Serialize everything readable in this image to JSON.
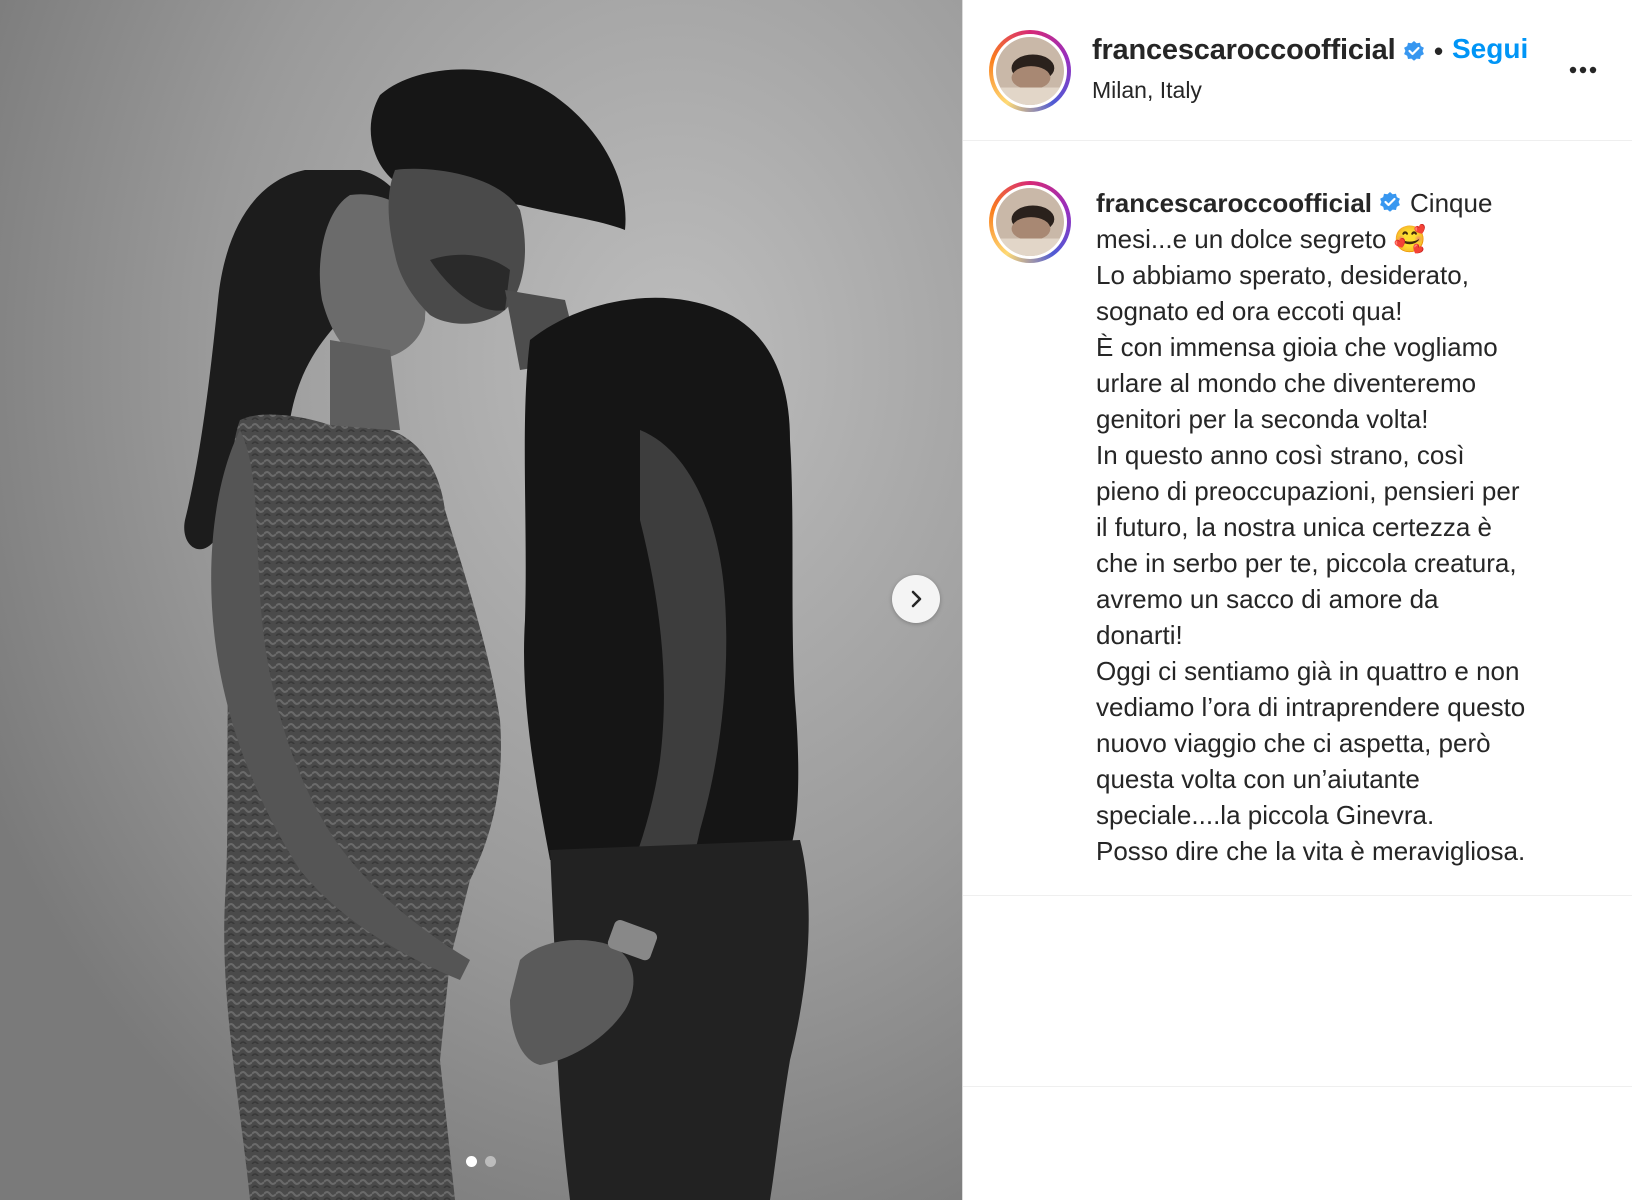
{
  "post": {
    "username": "francescaroccoofficial",
    "follow_label": "Segui",
    "separator": "•",
    "location": "Milan, Italy",
    "verified": true
  },
  "caption": {
    "username": "francescaroccoofficial",
    "first_line_text": "Cinque",
    "lines": [
      "mesi...e un dolce segreto 🥰",
      "Lo abbiamo sperato, desiderato,",
      "sognato ed ora eccoti qua!",
      "È con immensa gioia che vogliamo",
      "urlare al mondo che diventeremo",
      "genitori per la seconda volta!",
      "In questo anno così strano, così",
      "pieno di preoccupazioni, pensieri per",
      "il futuro, la nostra unica certezza è",
      "che in serbo per te, piccola creatura,",
      "avremo un sacco di amore da",
      "donarti!",
      "Oggi ci sentiamo già in quattro e non",
      "vediamo l’ora di intraprendere questo",
      "nuovo viaggio che ci aspetta, però",
      "questa volta con un’aiutante",
      "speciale....la piccola Ginevra.",
      "Posso dire che la vita è meravigliosa."
    ]
  },
  "carousel": {
    "total_slides": 2,
    "active_slide": 1
  },
  "colors": {
    "accent": "#0095f6",
    "verified": "#3897f0",
    "text": "#262626",
    "border": "#dbdbdb"
  },
  "icons": {
    "verified": "verified-badge-icon",
    "more": "more-options-icon",
    "next": "chevron-right-icon"
  }
}
